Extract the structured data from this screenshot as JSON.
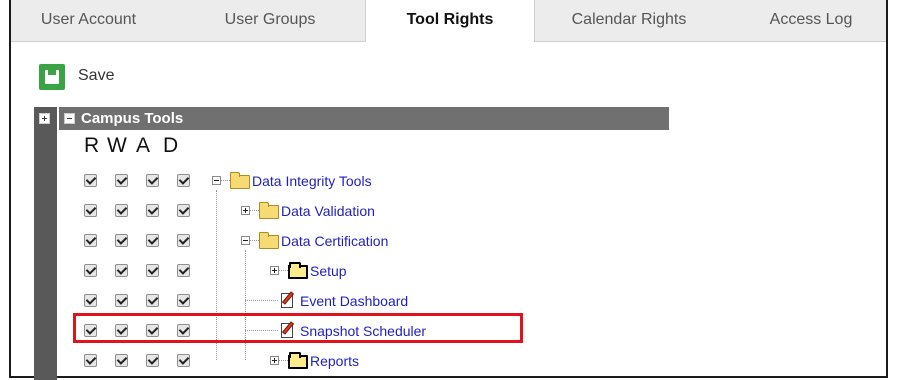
{
  "tabs": [
    {
      "label": "User Account",
      "active": false
    },
    {
      "label": "User Groups",
      "active": false
    },
    {
      "label": "Tool Rights",
      "active": true
    },
    {
      "label": "Calendar Rights",
      "active": false
    },
    {
      "label": "Access Log",
      "active": false
    }
  ],
  "toolbar": {
    "save_label": "Save"
  },
  "tree": {
    "root_label": "Campus Tools",
    "perm_headers": [
      "R",
      "W",
      "A",
      "D"
    ],
    "nodes": [
      {
        "label": "Data Integrity Tools",
        "icon": "folder-icon",
        "expanded": true,
        "level": 0,
        "checked": [
          true,
          true,
          true,
          true
        ]
      },
      {
        "label": "Data Validation",
        "icon": "folder-icon",
        "expanded": false,
        "level": 1,
        "checked": [
          true,
          true,
          true,
          true
        ]
      },
      {
        "label": "Data Certification",
        "icon": "folder-icon",
        "expanded": true,
        "level": 1,
        "checked": [
          true,
          true,
          true,
          true
        ]
      },
      {
        "label": "Setup",
        "icon": "folder-icon",
        "expanded": false,
        "level": 2,
        "checked": [
          true,
          true,
          true,
          true
        ]
      },
      {
        "label": "Event Dashboard",
        "icon": "page-edit-icon",
        "level": 2,
        "checked": [
          true,
          true,
          true,
          true
        ]
      },
      {
        "label": "Snapshot Scheduler",
        "icon": "page-edit-icon",
        "level": 2,
        "highlighted": true,
        "checked": [
          true,
          true,
          true,
          true
        ]
      },
      {
        "label": "Reports",
        "icon": "folder-icon",
        "expanded": false,
        "level": 2,
        "checked": [
          true,
          true,
          true,
          true
        ]
      }
    ]
  },
  "colors": {
    "highlight": "#e0141d",
    "save_icon": "#3aa346",
    "link": "#1f1fbf",
    "header_bar": "#707070"
  }
}
